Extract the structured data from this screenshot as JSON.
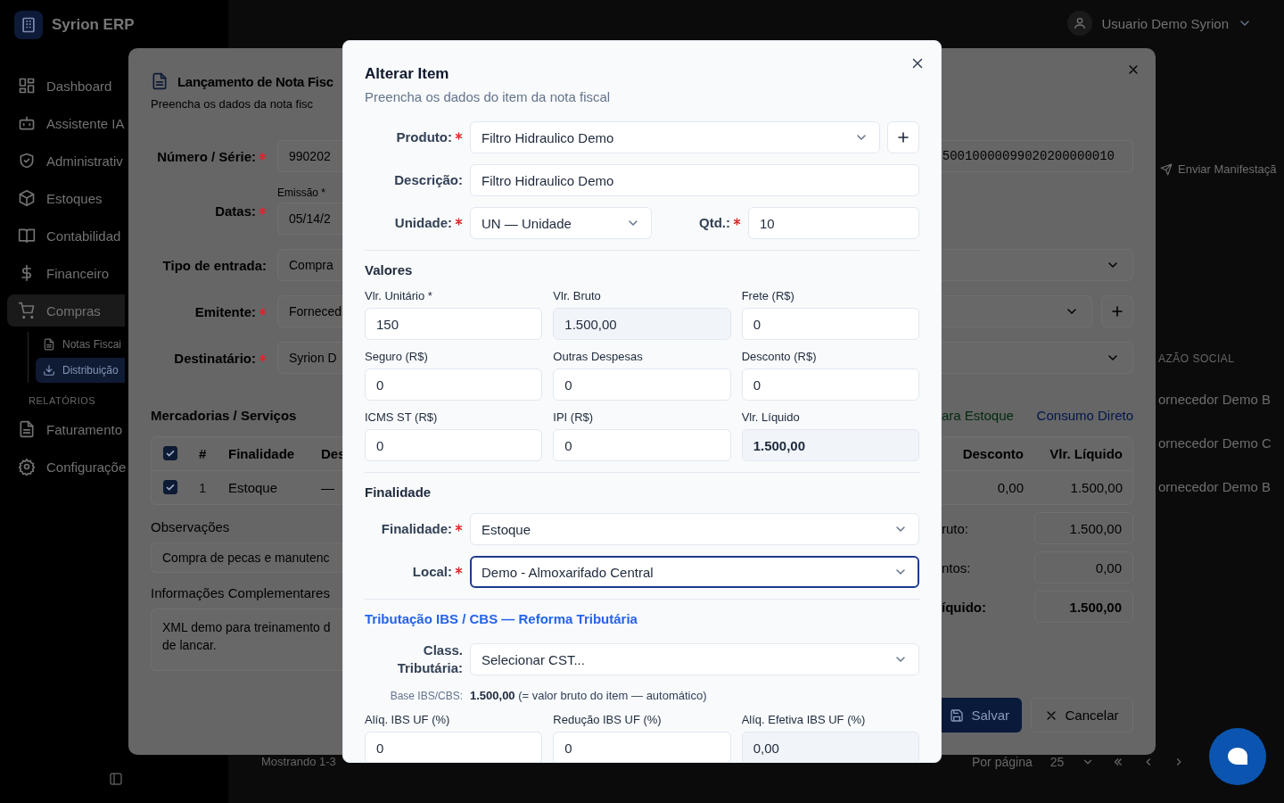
{
  "sidebar": {
    "brand": "Syrion ERP",
    "items": [
      {
        "kind": "dashboard",
        "label": "Dashboard",
        "selected": false
      },
      {
        "kind": "bot",
        "label": "Assistente IA",
        "selected": false
      },
      {
        "kind": "shield",
        "label": "Administrativ",
        "selected": false
      },
      {
        "kind": "box",
        "label": "Estoques",
        "selected": false
      },
      {
        "kind": "book",
        "label": "Contabilidad",
        "selected": false
      },
      {
        "kind": "dollar",
        "label": "Financeiro",
        "selected": false
      },
      {
        "kind": "cart",
        "label": "Compras",
        "selected": true,
        "children": [
          {
            "kind": "doc",
            "label": "Notas Fiscai",
            "selected": false
          },
          {
            "kind": "download",
            "label": "Distribuição",
            "selected": true
          }
        ],
        "subsection": "RELATÓRIOS"
      },
      {
        "kind": "doc",
        "label": "Faturamento",
        "selected": false
      },
      {
        "kind": "gear",
        "label": "Configuraçõe",
        "selected": false
      }
    ]
  },
  "top_bar": {
    "user": "Usuario Demo Syrion"
  },
  "page": {
    "send_button": "Enviar Manifestaçã",
    "column_header": "AZÃO SOCIAL",
    "rows": [
      {
        "name": "ornecedor Demo B"
      },
      {
        "name": "ornecedor Demo C"
      },
      {
        "name": "ornecedor Demo B"
      }
    ],
    "pagination": {
      "summary": "Mostrando 1-3",
      "per_page_label": "Por página",
      "per_page": "25"
    }
  },
  "note_dialog": {
    "title": "Lançamento de Nota Fisc",
    "subtitle": "Preencha os dados da nota fisc",
    "fields": [
      {
        "label": "Número / Série:",
        "required": true,
        "value": "990202"
      },
      {
        "label": "Datas:",
        "required": true,
        "caption": "Emissão *",
        "value": "05/14/2"
      },
      {
        "label": "Tipo de entrada:",
        "required": false,
        "value": "Compra"
      },
      {
        "label": "Emitente:",
        "required": true,
        "value": "Forneced"
      },
      {
        "label": "Destinatário:",
        "required": true,
        "value": "Syrion D"
      }
    ],
    "access_key": "50010000099020200000010",
    "items_heading": "Mercadorias / Serviços",
    "purpose_links": [
      "ara Estoque",
      "Consumo Direto"
    ],
    "table": {
      "columns": [
        "#",
        "Finalidade",
        "Des"
      ],
      "all_checked": true,
      "rows": [
        {
          "checked": true,
          "cells": [
            "1",
            "Estoque",
            "—"
          ]
        }
      ]
    },
    "right_table": {
      "columns": [
        "Desconto",
        "Vlr. Líquido"
      ],
      "rows": [
        {
          "cells": [
            "0,00",
            "1.500,00"
          ]
        }
      ]
    },
    "notes": {
      "label": "Observações",
      "value": "Compra de pecas e manutenc"
    },
    "extra_info": {
      "label": "Informações Complementares",
      "value": "XML demo para treinamento d\nde lancar."
    },
    "totals": [
      {
        "label": "ruto:",
        "value": "1.500,00",
        "bold": false
      },
      {
        "label": "ntos:",
        "value": "0,00",
        "bold": false
      },
      {
        "label": "íquido:",
        "value": "1.500,00",
        "bold": true
      }
    ],
    "buttons": [
      "Salvar",
      "Cancelar"
    ]
  },
  "item_dialog": {
    "title": "Alterar Item",
    "subtitle": "Preencha os dados do item da nota fiscal",
    "product": {
      "label": "Produto:",
      "required": true,
      "value": "Filtro Hidraulico Demo"
    },
    "description": {
      "label": "Descrição:",
      "required": false,
      "value": "Filtro Hidraulico Demo"
    },
    "unit": {
      "label": "Unidade:",
      "required": true,
      "value": "UN — Unidade"
    },
    "quantity": {
      "label": "Qtd.:",
      "required": true,
      "value": "10"
    },
    "values_section": {
      "heading": "Valores",
      "fields": [
        {
          "label": "Vlr. Unitário *",
          "value": "150",
          "readonly": false,
          "bold": false
        },
        {
          "label": "Vlr. Bruto",
          "value": "1.500,00",
          "readonly": true,
          "bold": false
        },
        {
          "label": "Frete (R$)",
          "value": "0",
          "readonly": false,
          "bold": false
        },
        {
          "label": "Seguro (R$)",
          "value": "0",
          "readonly": false,
          "bold": false
        },
        {
          "label": "Outras Despesas",
          "value": "0",
          "readonly": false,
          "bold": false
        },
        {
          "label": "Desconto (R$)",
          "value": "0",
          "readonly": false,
          "bold": false
        },
        {
          "label": "ICMS ST (R$)",
          "value": "0",
          "readonly": false,
          "bold": false
        },
        {
          "label": "IPI (R$)",
          "value": "0",
          "readonly": false,
          "bold": false
        },
        {
          "label": "Vlr. Líquido",
          "value": "1.500,00",
          "readonly": true,
          "bold": true
        }
      ]
    },
    "purpose_section": {
      "heading": "Finalidade",
      "selects": [
        {
          "label": "Finalidade:",
          "required": true,
          "value": "Estoque",
          "focused": false
        },
        {
          "label": "Local:",
          "required": true,
          "value": "Demo - Almoxarifado Central",
          "focused": true
        }
      ]
    },
    "tax_section": {
      "heading": "Tributação IBS / CBS — Reforma Tributária",
      "classification": {
        "label": "Class. Tributária:",
        "required": false,
        "placeholder": "Selecionar CST..."
      },
      "base": {
        "label": "Base IBS/CBS:",
        "text": "**1.500,00** (= valor bruto do item — automático)"
      },
      "fields": [
        {
          "label": "Alíq. IBS UF (%)",
          "value": "0",
          "readonly": false,
          "bold": false
        },
        {
          "label": "Redução IBS UF (%)",
          "value": "0",
          "readonly": false,
          "bold": false
        },
        {
          "label": "Alíq. Efetiva IBS UF (%)",
          "value": "0,00",
          "readonly": true,
          "bold": false
        }
      ]
    }
  }
}
